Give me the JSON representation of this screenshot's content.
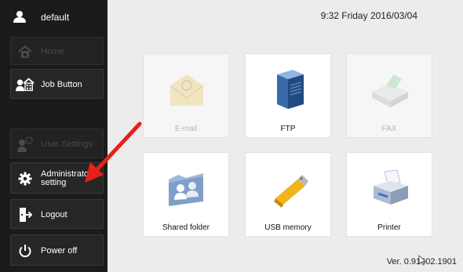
{
  "header": {
    "user_name": "default",
    "datetime": "9:32 Friday 2016/03/04"
  },
  "sidebar": {
    "items": [
      {
        "label": "Home",
        "icon": "home-icon",
        "enabled": false
      },
      {
        "label": "Job Button",
        "icon": "job-button-icon",
        "enabled": true
      },
      {
        "label": "User Settings",
        "icon": "user-settings-icon",
        "enabled": false
      },
      {
        "label": "Administrator\nsetting",
        "icon": "gear-icon",
        "enabled": true
      },
      {
        "label": "Logout",
        "icon": "logout-icon",
        "enabled": true
      },
      {
        "label": "Power off",
        "icon": "power-icon",
        "enabled": true
      }
    ]
  },
  "tiles": [
    {
      "label": "E-mail",
      "icon": "envelope-icon",
      "enabled": false
    },
    {
      "label": "FTP",
      "icon": "server-icon",
      "enabled": true
    },
    {
      "label": "FAX",
      "icon": "fax-icon",
      "enabled": false
    },
    {
      "label": "Shared folder",
      "icon": "shared-folder-icon",
      "enabled": true
    },
    {
      "label": "USB memory",
      "icon": "usb-memory-icon",
      "enabled": true
    },
    {
      "label": "Printer",
      "icon": "printer-icon",
      "enabled": true
    }
  ],
  "footer": {
    "version": "Ver. 0.91602.1901"
  },
  "colors": {
    "sidebar_bg": "#1b1b1b",
    "main_bg": "#ececec",
    "annotation_arrow": "#e8201a"
  }
}
